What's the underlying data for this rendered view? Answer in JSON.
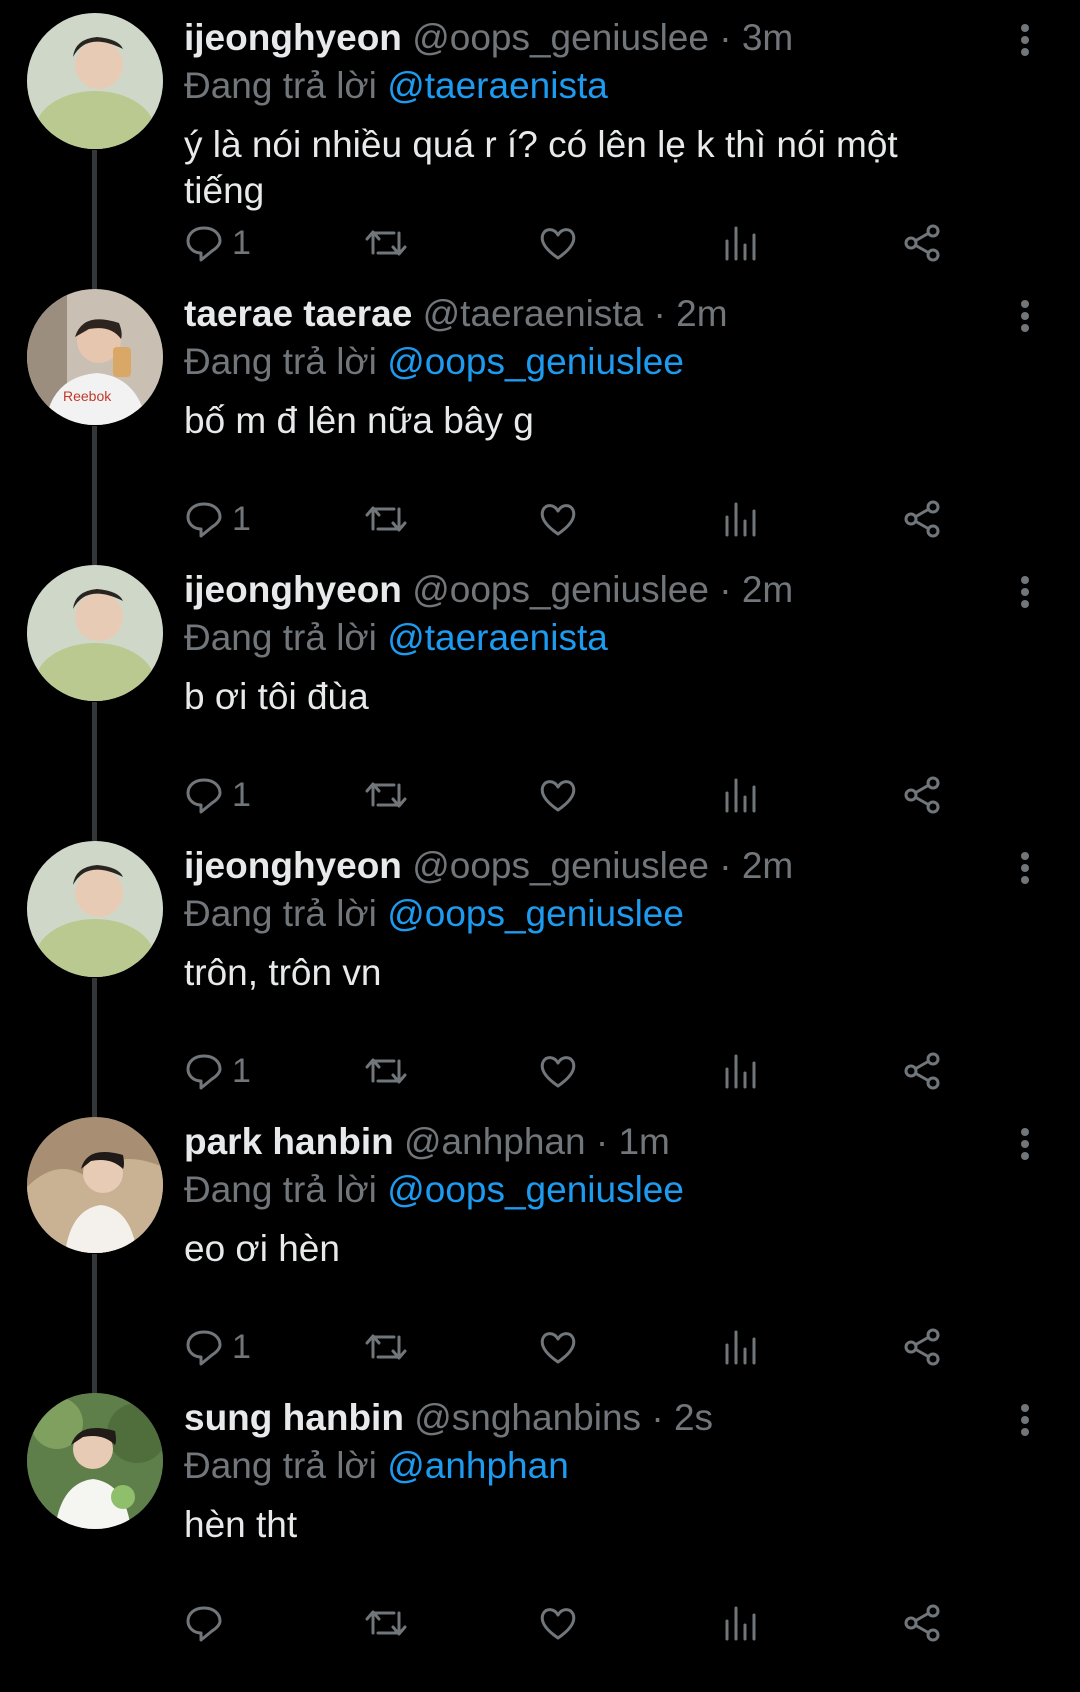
{
  "colors": {
    "background": "#000000",
    "text": "#e7e9ea",
    "secondary": "#71767b",
    "accent": "#1d9bf0",
    "thread_line": "#333639"
  },
  "icons": {
    "reply": "reply-icon",
    "retweet": "retweet-icon",
    "like": "heart-icon",
    "views": "views-icon",
    "share": "share-icon",
    "more": "more-vertical-icon"
  },
  "tweets": [
    {
      "name": "ijeonghyeon",
      "handle": "@oops_geniuslee",
      "dot": "·",
      "time": "3m",
      "reply_prefix": "Đang trả lời",
      "reply_to": "@taeraenista",
      "text": "ý là nói nhiều quá r í? có lên lẹ k thì nói một tiếng",
      "reply_count": "1"
    },
    {
      "name": "taerae taerae",
      "handle": "@taeraenista",
      "dot": "·",
      "time": "2m",
      "reply_prefix": "Đang trả lời",
      "reply_to": "@oops_geniuslee",
      "text": "bố m đ lên nữa bây g",
      "reply_count": "1"
    },
    {
      "name": "ijeonghyeon",
      "handle": "@oops_geniuslee",
      "dot": "·",
      "time": "2m",
      "reply_prefix": "Đang trả lời",
      "reply_to": "@taeraenista",
      "text": "b ơi tôi đùa",
      "reply_count": "1"
    },
    {
      "name": "ijeonghyeon",
      "handle": "@oops_geniuslee",
      "dot": "·",
      "time": "2m",
      "reply_prefix": "Đang trả lời",
      "reply_to": "@oops_geniuslee",
      "text": "trôn, trôn vn",
      "reply_count": "1"
    },
    {
      "name": "park hanbin",
      "handle": "@anhphan",
      "dot": "·",
      "time": "1m",
      "reply_prefix": "Đang trả lời",
      "reply_to": "@oops_geniuslee",
      "text": "eo ơi hèn",
      "reply_count": "1"
    },
    {
      "name": "sung hanbin",
      "handle": "@snghanbins",
      "dot": "·",
      "time": "2s",
      "reply_prefix": "Đang trả lời",
      "reply_to": "@anhphan",
      "text": "hèn tht",
      "reply_count": ""
    }
  ]
}
